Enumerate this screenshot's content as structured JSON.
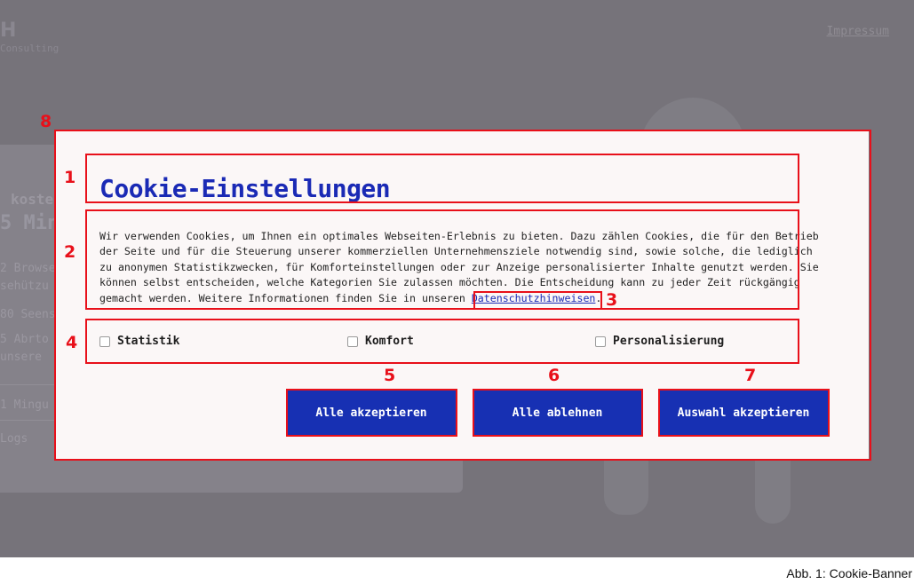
{
  "background_page": {
    "logo_text": "H",
    "logo_subtext": "Consulting",
    "impressum_link": "Impressum",
    "card_lines": [
      "koste",
      "5 Min",
      "2 Browse",
      "sehützu",
      "80 Seens",
      "5 Abrto",
      "unsere",
      "1 Mingu",
      "Logs"
    ]
  },
  "modal": {
    "title": "Cookie-Einstellungen",
    "body_text": "Wir verwenden Cookies, um Ihnen ein optimales Webseiten-Erlebnis zu bieten. Dazu zählen Cookies, die für den Betrieb der Seite und für die Steuerung unserer kommerziellen Unternehmensziele notwendig sind, sowie solche, die lediglich zu anonymen Statistikzwecken, für Komforteinstellungen oder zur Anzeige personalisierter Inhalte genutzt werden. Sie können selbst entscheiden, welche Kategorien Sie zulassen möchten. Die Entscheidung kann zu jeder Zeit rückgängig gemacht werden. Weitere Informationen finden Sie in unseren",
    "privacy_link": "Datenschutzhinweisen",
    "body_end": ".",
    "categories": [
      {
        "label": "Statistik",
        "checked": false
      },
      {
        "label": "Komfort",
        "checked": false
      },
      {
        "label": "Personalisierung",
        "checked": false
      }
    ],
    "buttons": {
      "accept_all": "Alle akzeptieren",
      "reject_all": "Alle ablehnen",
      "accept_selection": "Auswahl akzeptieren"
    }
  },
  "annotations": [
    "1",
    "2",
    "3",
    "4",
    "5",
    "6",
    "7",
    "8"
  ],
  "caption": "Abb. 1: Cookie-Banner",
  "colors": {
    "annotation_red": "#e8101a",
    "button_blue": "#1730b3",
    "title_blue": "#1a2ab5",
    "overlay": "#76737a",
    "modal_bg": "#fbf7f7"
  }
}
